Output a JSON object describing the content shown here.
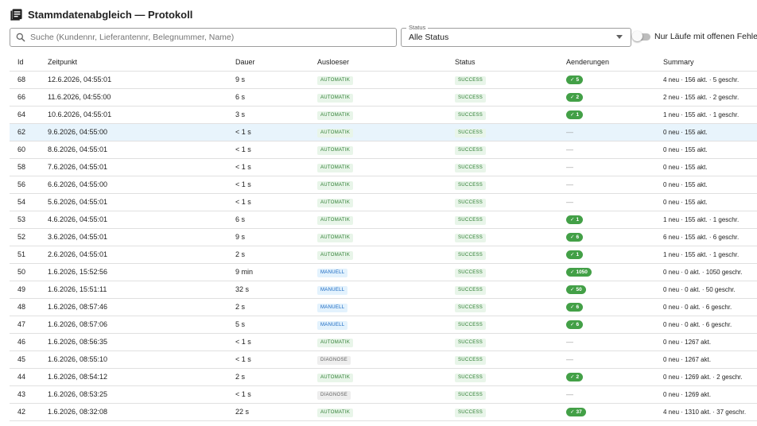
{
  "header": {
    "title": "Stammdatenabgleich — Protokoll",
    "icon": "document-list-icon"
  },
  "search": {
    "value": "",
    "placeholder": "Suche (Kundennr, Lieferantennr, Belegnummer, Name)"
  },
  "status_filter": {
    "label": "Status",
    "value": "Alle Status"
  },
  "open_errors_toggle": {
    "label": "Nur Läufe mit offenen Fehlern",
    "checked": false
  },
  "columns": [
    "Id",
    "Zeitpunkt",
    "Dauer",
    "Ausloeser",
    "Status",
    "Aenderungen",
    "Summary"
  ],
  "rows": [
    {
      "id": "68",
      "time": "12.6.2026, 04:55:01",
      "duration": "9 s",
      "trigger": "AUTOMATIK",
      "status": "SUCCESS",
      "changes": "5",
      "summary": "4 neu · 156 akt. · 5 geschr."
    },
    {
      "id": "66",
      "time": "11.6.2026, 04:55:00",
      "duration": "6 s",
      "trigger": "AUTOMATIK",
      "status": "SUCCESS",
      "changes": "2",
      "summary": "2 neu · 155 akt. · 2 geschr."
    },
    {
      "id": "64",
      "time": "10.6.2026, 04:55:01",
      "duration": "3 s",
      "trigger": "AUTOMATIK",
      "status": "SUCCESS",
      "changes": "1",
      "summary": "1 neu · 155 akt. · 1 geschr."
    },
    {
      "id": "62",
      "time": "9.6.2026, 04:55:00",
      "duration": "< 1 s",
      "trigger": "AUTOMATIK",
      "status": "SUCCESS",
      "changes": "",
      "summary": "0 neu · 155 akt.",
      "selected": true
    },
    {
      "id": "60",
      "time": "8.6.2026, 04:55:01",
      "duration": "< 1 s",
      "trigger": "AUTOMATIK",
      "status": "SUCCESS",
      "changes": "",
      "summary": "0 neu · 155 akt."
    },
    {
      "id": "58",
      "time": "7.6.2026, 04:55:01",
      "duration": "< 1 s",
      "trigger": "AUTOMATIK",
      "status": "SUCCESS",
      "changes": "",
      "summary": "0 neu · 155 akt."
    },
    {
      "id": "56",
      "time": "6.6.2026, 04:55:00",
      "duration": "< 1 s",
      "trigger": "AUTOMATIK",
      "status": "SUCCESS",
      "changes": "",
      "summary": "0 neu · 155 akt."
    },
    {
      "id": "54",
      "time": "5.6.2026, 04:55:01",
      "duration": "< 1 s",
      "trigger": "AUTOMATIK",
      "status": "SUCCESS",
      "changes": "",
      "summary": "0 neu · 155 akt."
    },
    {
      "id": "53",
      "time": "4.6.2026, 04:55:01",
      "duration": "6 s",
      "trigger": "AUTOMATIK",
      "status": "SUCCESS",
      "changes": "1",
      "summary": "1 neu · 155 akt. · 1 geschr."
    },
    {
      "id": "52",
      "time": "3.6.2026, 04:55:01",
      "duration": "9 s",
      "trigger": "AUTOMATIK",
      "status": "SUCCESS",
      "changes": "6",
      "summary": "6 neu · 155 akt. · 6 geschr."
    },
    {
      "id": "51",
      "time": "2.6.2026, 04:55:01",
      "duration": "2 s",
      "trigger": "AUTOMATIK",
      "status": "SUCCESS",
      "changes": "1",
      "summary": "1 neu · 155 akt. · 1 geschr."
    },
    {
      "id": "50",
      "time": "1.6.2026, 15:52:56",
      "duration": "9 min",
      "trigger": "MANUELL",
      "status": "SUCCESS",
      "changes": "1050",
      "summary": "0 neu · 0 akt. · 1050 geschr."
    },
    {
      "id": "49",
      "time": "1.6.2026, 15:51:11",
      "duration": "32 s",
      "trigger": "MANUELL",
      "status": "SUCCESS",
      "changes": "50",
      "summary": "0 neu · 0 akt. · 50 geschr."
    },
    {
      "id": "48",
      "time": "1.6.2026, 08:57:46",
      "duration": "2 s",
      "trigger": "MANUELL",
      "status": "SUCCESS",
      "changes": "6",
      "summary": "0 neu · 0 akt. · 6 geschr."
    },
    {
      "id": "47",
      "time": "1.6.2026, 08:57:06",
      "duration": "5 s",
      "trigger": "MANUELL",
      "status": "SUCCESS",
      "changes": "6",
      "summary": "0 neu · 0 akt. · 6 geschr."
    },
    {
      "id": "46",
      "time": "1.6.2026, 08:56:35",
      "duration": "< 1 s",
      "trigger": "AUTOMATIK",
      "status": "SUCCESS",
      "changes": "",
      "summary": "0 neu · 1267 akt."
    },
    {
      "id": "45",
      "time": "1.6.2026, 08:55:10",
      "duration": "< 1 s",
      "trigger": "DIAGNOSE",
      "status": "SUCCESS",
      "changes": "",
      "summary": "0 neu · 1267 akt."
    },
    {
      "id": "44",
      "time": "1.6.2026, 08:54:12",
      "duration": "2 s",
      "trigger": "AUTOMATIK",
      "status": "SUCCESS",
      "changes": "2",
      "summary": "0 neu · 1269 akt. · 2 geschr."
    },
    {
      "id": "43",
      "time": "1.6.2026, 08:53:25",
      "duration": "< 1 s",
      "trigger": "DIAGNOSE",
      "status": "SUCCESS",
      "changes": "",
      "summary": "0 neu · 1269 akt."
    },
    {
      "id": "42",
      "time": "1.6.2026, 08:32:08",
      "duration": "22 s",
      "trigger": "AUTOMATIK",
      "status": "SUCCESS",
      "changes": "37",
      "summary": "4 neu · 1310 akt. · 37 geschr."
    }
  ],
  "empty_change_marker": "—",
  "colors": {
    "success": "#43a047",
    "automatic_chip_text": "#2e7d32",
    "manual_chip_text": "#1565c0",
    "selected_row": "#e8f4fc"
  }
}
